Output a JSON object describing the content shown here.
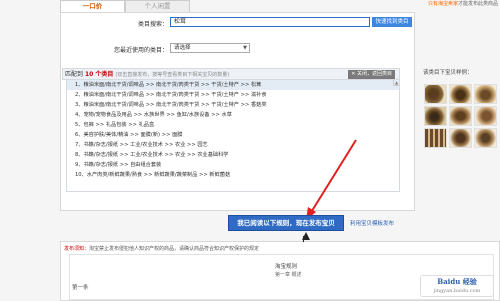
{
  "tabs": [
    {
      "label": "一口价",
      "active": true
    },
    {
      "label": "个人闲置",
      "active": false
    }
  ],
  "top_note": {
    "warn": "只有海宝卖家",
    "rest": "才能发布此类商品"
  },
  "search": {
    "label": "类目搜索：",
    "value": "松茸",
    "button": "快速找到类目"
  },
  "recent": {
    "label": "您最近使用的类目：",
    "select_value": "请选择"
  },
  "results": {
    "prefix": "匹配到",
    "count": "10 个类目",
    "hint": "(双击直接发布，按等号查看类目下相关宝贝的数量)",
    "close": "关闭，返回类目",
    "items": [
      "1、粮油米面/南北干货/调味品 >> 南北干货/肉类干货 >> 干货/土特产 >> 松茸",
      "2、粮油米面/南北干货/调味品 >> 南北干货/肉类干货 >> 干货/土特产 >> 滋补食",
      "3、粮油米面/南北干货/调味品 >> 南北干货/肉类干货 >> 干货/土特产 >> 香菇类",
      "4、宠物/宠物食品及用品 >> 水族世界 >> 鱼缸/水族设备 >> 水草",
      "5、包裤 >> 礼品包装 >> 礼品盒",
      "6、美容护肤/美体/精油 >> 面膜(新) >> 面膜",
      "7、书籍/杂志/报纸 >> 工业/农业技术 >> 农业 >> 园艺",
      "8、书籍/杂志/报纸 >> 工业/农业技术 >> 农业 >> 农业基础科学",
      "9、书籍/杂志/报纸 >> 自由组合套装",
      "10、水产肉类/新鲜蔬果/熟食 >> 新鲜蔬果/蔬菜制品 >> 新鲜菌菇"
    ],
    "selected_index": 0
  },
  "examples": {
    "title": "该类目下宝贝样例："
  },
  "publish_button": "我已阅读以下规则，现在发布宝贝",
  "template_link": "利用宝贝模板发布",
  "bottom": {
    "note_prefix": "发布须知：",
    "note": "淘宝禁止发布侵犯他人知识产权的商品，请确认商品符合知识产权保护的规定",
    "doc_title": "淘宝规则",
    "doc_sub": "第一章 概述",
    "doc_left": "第一条"
  },
  "watermark": {
    "main": "Baidu 经验",
    "sub": "jingyan.baidu.com"
  }
}
